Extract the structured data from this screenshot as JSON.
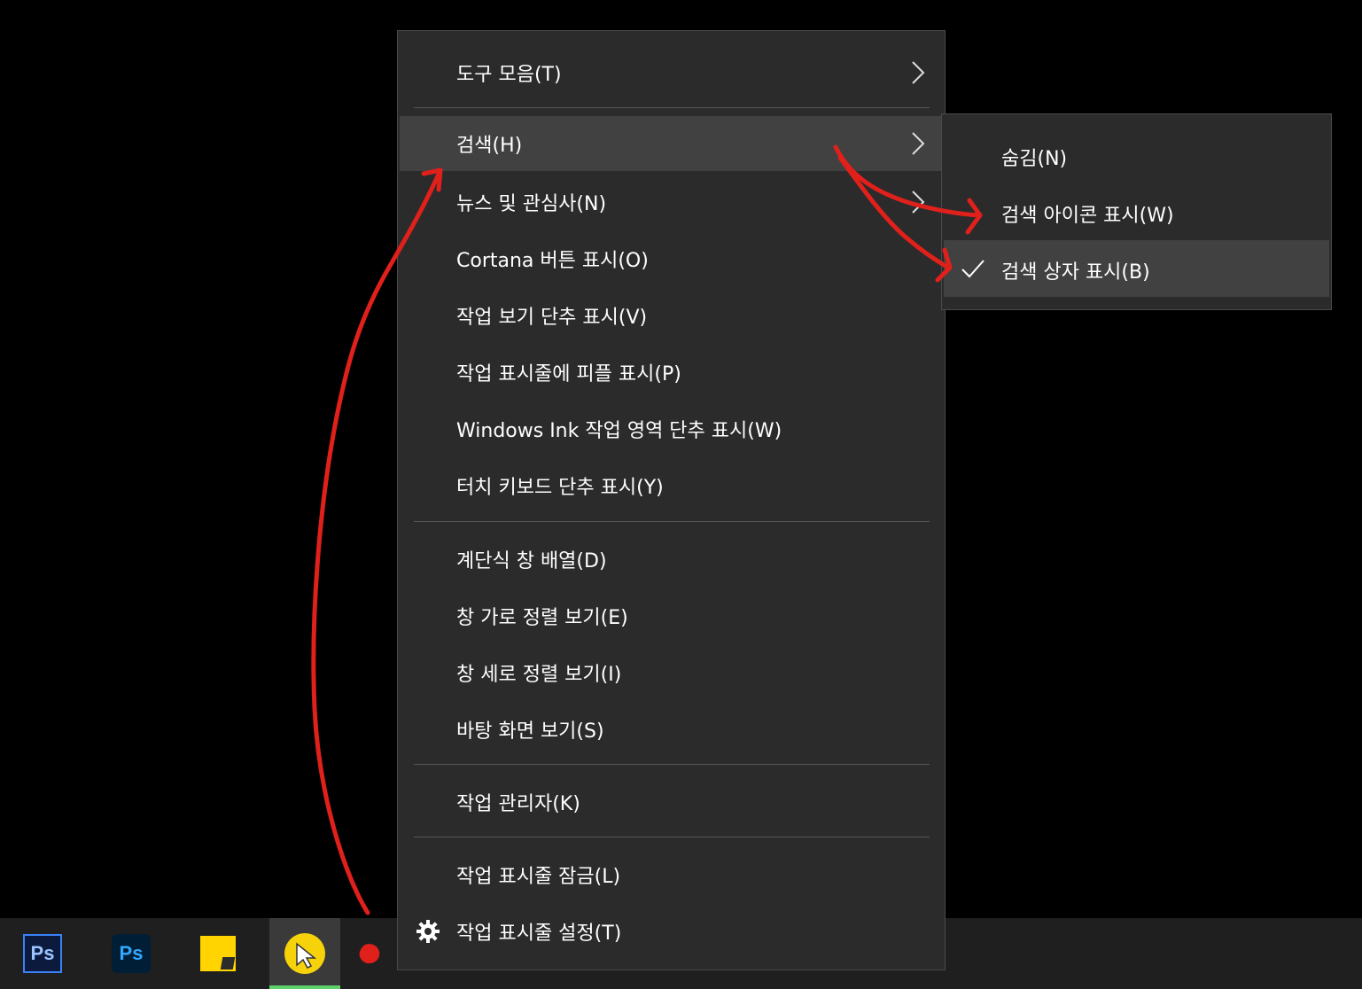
{
  "menu": {
    "items": [
      {
        "label": "도구 모음(T)",
        "has_submenu": true
      },
      {
        "label": "검색(H)",
        "has_submenu": true
      },
      {
        "label": "뉴스 및 관심사(N)",
        "has_submenu": true
      },
      {
        "label": "Cortana 버튼 표시(O)"
      },
      {
        "label": "작업 보기 단추 표시(V)"
      },
      {
        "label": "작업 표시줄에 피플 표시(P)"
      },
      {
        "label": "Windows Ink 작업 영역 단추 표시(W)"
      },
      {
        "label": "터치 키보드 단추 표시(Y)"
      },
      {
        "label": "계단식 창 배열(D)"
      },
      {
        "label": "창 가로 정렬 보기(E)"
      },
      {
        "label": "창 세로 정렬 보기(I)"
      },
      {
        "label": "바탕 화면 보기(S)"
      },
      {
        "label": "작업 관리자(K)"
      },
      {
        "label": "작업 표시줄 잠금(L)"
      },
      {
        "label": "작업 표시줄 설정(T)",
        "icon": "gear-icon"
      }
    ],
    "highlighted": "검색(H)"
  },
  "submenu": {
    "items": [
      {
        "label": "숨김(N)"
      },
      {
        "label": "검색 아이콘 표시(W)"
      },
      {
        "label": "검색 상자 표시(B)",
        "checked": true
      }
    ]
  },
  "taskbar": {
    "icons": [
      {
        "name": "photoshop-cs-icon",
        "text": "Ps"
      },
      {
        "name": "photoshop-cc-icon",
        "text": "Ps"
      },
      {
        "name": "sticky-notes-icon"
      },
      {
        "name": "screen-recorder-icon",
        "active": true
      },
      {
        "name": "red-dot-icon"
      }
    ]
  },
  "colors": {
    "menu_bg": "#2b2b2b",
    "hover_bg": "#414141",
    "annotation_red": "#e0201b",
    "active_indicator": "#5fd16a"
  }
}
